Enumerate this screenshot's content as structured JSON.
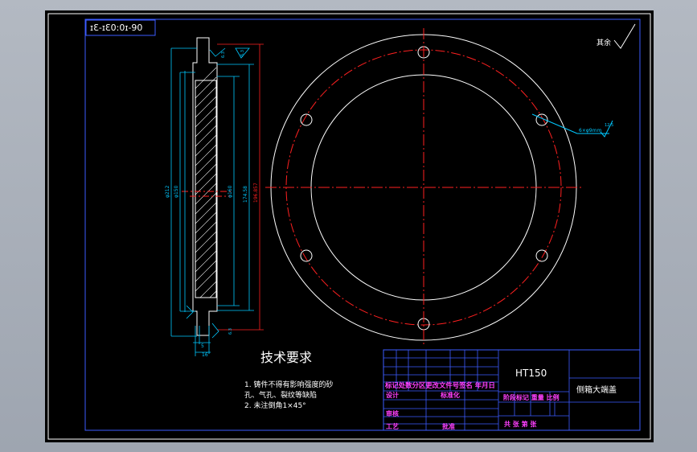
{
  "drawing": {
    "code": "ɪƐ-ɪƐ0:0ɪ-90",
    "roughness_note": "其余",
    "roughness_value": "6.3",
    "hole_spec": "6×φ9mm",
    "hole_roughness": "12.5",
    "dimensions": {
      "d212": "φ212",
      "d150a": "φ150",
      "d160": "φ160",
      "d174": "174.58",
      "d196": "196.857",
      "w5": "5",
      "w16": "16",
      "r63a": "6.3",
      "r63b": "6.3",
      "r63c": "6.3"
    },
    "tech": {
      "title": "技术要求",
      "line1": "1. 铸件不得有影响强度的砂",
      "line2": "孔、气孔、裂纹等缺陷",
      "line3": "2. 未注倒角1×45°"
    },
    "title_block": {
      "material": "HT150",
      "part_name": "侧箱大端盖",
      "header_row": "标记处数分区更改文件号签名 年月日",
      "design": "设计",
      "standard": "标准化",
      "stage_labels": "阶段标记 重量 比例",
      "review": "审核",
      "process": "工艺",
      "approve": "批准",
      "sheets": "共 张 第 张"
    }
  }
}
